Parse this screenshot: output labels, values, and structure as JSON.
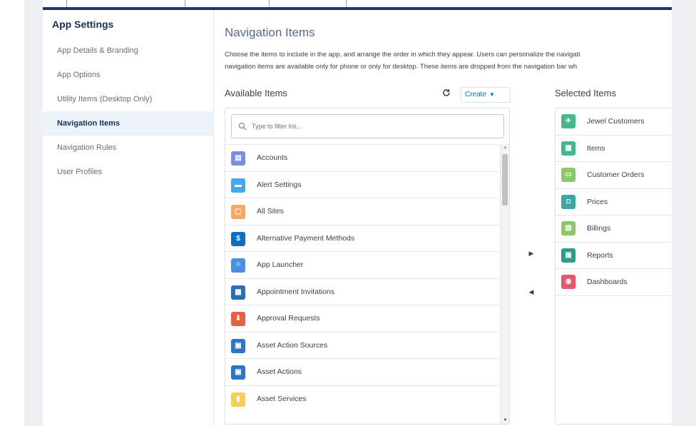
{
  "sidebar": {
    "title": "App Settings",
    "items": [
      {
        "label": "App Details & Branding",
        "active": false
      },
      {
        "label": "App Options",
        "active": false
      },
      {
        "label": "Utility Items (Desktop Only)",
        "active": false
      },
      {
        "label": "Navigation Items",
        "active": true
      },
      {
        "label": "Navigation Rules",
        "active": false
      },
      {
        "label": "User Profiles",
        "active": false
      }
    ]
  },
  "main": {
    "title": "Navigation Items",
    "description_line1": "Choose the items to include in the app, and arrange the order in which they appear. Users can personalize the navigati",
    "description_line2": "navigation items are available only for phone or only for desktop. These items are dropped from the navigation bar wh"
  },
  "available": {
    "label": "Available Items",
    "refresh_icon": "refresh-icon",
    "create_label": "Create",
    "search_placeholder": "Type to filter list...",
    "items": [
      {
        "label": "Accounts",
        "color": "#7f8de1",
        "glyph": "▤",
        "icon": "account-icon"
      },
      {
        "label": "Alert Settings",
        "color": "#47a7e6",
        "glyph": "▬",
        "icon": "alert-icon"
      },
      {
        "label": "All Sites",
        "color": "#f9a860",
        "glyph": "▢",
        "icon": "sites-icon"
      },
      {
        "label": "Alternative Payment Methods",
        "color": "#0d6ec2",
        "glyph": "$",
        "icon": "payment-icon"
      },
      {
        "label": "App Launcher",
        "color": "#4a8fe0",
        "glyph": "⁘",
        "icon": "app-launcher-icon"
      },
      {
        "label": "Appointment Invitations",
        "color": "#2b6fb6",
        "glyph": "▦",
        "icon": "calendar-icon"
      },
      {
        "label": "Approval Requests",
        "color": "#e5603e",
        "glyph": "⬇",
        "icon": "approval-icon"
      },
      {
        "label": "Asset Action Sources",
        "color": "#2e74c9",
        "glyph": "▣",
        "icon": "asset-source-icon"
      },
      {
        "label": "Asset Actions",
        "color": "#2e74c9",
        "glyph": "▣",
        "icon": "asset-action-icon"
      },
      {
        "label": "Asset Services",
        "color": "#f3cf5a",
        "glyph": "▮",
        "icon": "asset-service-icon"
      }
    ]
  },
  "move": {
    "right": "▶",
    "left": "◀"
  },
  "selected": {
    "label": "Selected Items",
    "items": [
      {
        "label": "Jewel Customers",
        "color": "#43b98b",
        "glyph": "✈",
        "icon": "jewel-customers-icon"
      },
      {
        "label": "Items",
        "color": "#43b98b",
        "glyph": "▦",
        "icon": "items-icon"
      },
      {
        "label": "Customer Orders",
        "color": "#8bc86a",
        "glyph": "▭",
        "icon": "customer-orders-icon"
      },
      {
        "label": "Prices",
        "color": "#3ba7a3",
        "glyph": "◘",
        "icon": "prices-icon"
      },
      {
        "label": "Billings",
        "color": "#8bc86a",
        "glyph": "▤",
        "icon": "billings-icon"
      },
      {
        "label": "Reports",
        "color": "#2e9e83",
        "glyph": "▣",
        "icon": "reports-icon"
      },
      {
        "label": "Dashboards",
        "color": "#e8576e",
        "glyph": "◉",
        "icon": "dashboards-icon"
      }
    ]
  }
}
